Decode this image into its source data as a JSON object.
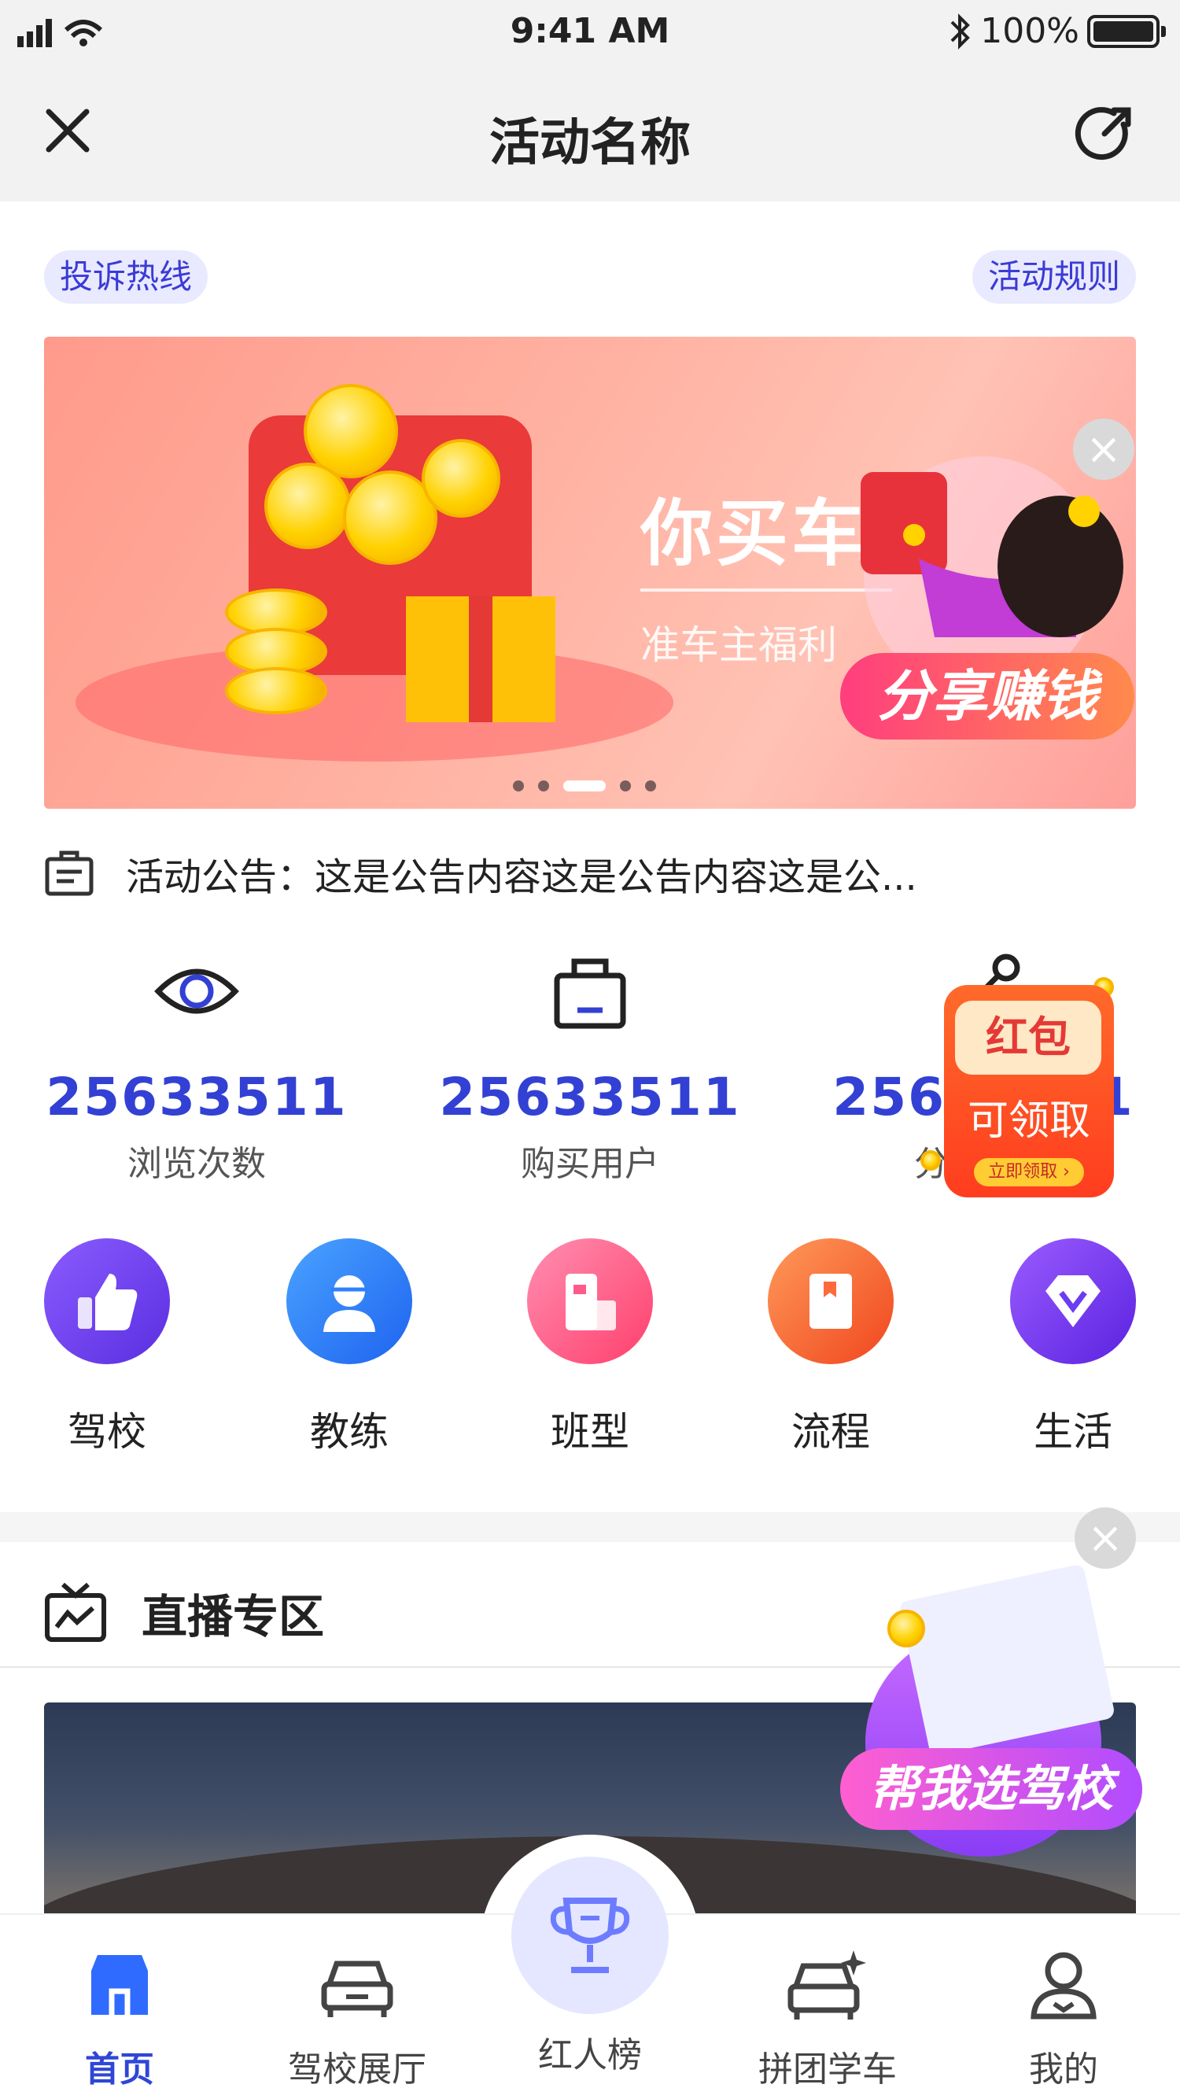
{
  "status_bar": {
    "time": "9:41 AM",
    "battery": "100%"
  },
  "nav": {
    "title": "活动名称"
  },
  "pills": {
    "complaint": "投诉热线",
    "rules": "活动规则"
  },
  "banner": {
    "headline": "你买车",
    "subline": "准车主福利",
    "carousel_total": 5,
    "carousel_active_index": 2
  },
  "share_float": {
    "label": "分享赚钱"
  },
  "notice": {
    "text": "活动公告：这是公告内容这是公告内容这是公..."
  },
  "stats": [
    {
      "value": "25633511",
      "label": "浏览次数"
    },
    {
      "value": "25633511",
      "label": "购买用户"
    },
    {
      "value": "25633511",
      "label": "分享次数"
    }
  ],
  "hongbao": {
    "title": "红包",
    "subtitle": "可领取",
    "action": "立即领取 ›"
  },
  "categories": [
    {
      "label": "驾校",
      "icon": "thumbs-up-icon",
      "color": "#6a3df0"
    },
    {
      "label": "教练",
      "icon": "coach-icon",
      "color": "#2f80ff"
    },
    {
      "label": "班型",
      "icon": "class-type-icon",
      "color": "#ff5a8a"
    },
    {
      "label": "流程",
      "icon": "process-book-icon",
      "color": "#ff6a3d"
    },
    {
      "label": "生活",
      "icon": "diamond-v-icon",
      "color": "#7b3df0"
    }
  ],
  "live": {
    "title": "直播专区"
  },
  "help_float": {
    "label": "帮我选驾校"
  },
  "tabs": [
    {
      "label": "首页",
      "icon": "home-icon",
      "active": true
    },
    {
      "label": "驾校展厅",
      "icon": "car-icon",
      "active": false
    },
    {
      "label": "红人榜",
      "icon": "trophy-icon",
      "active": false
    },
    {
      "label": "拼团学车",
      "icon": "car-sparkle-icon",
      "active": false
    },
    {
      "label": "我的",
      "icon": "user-icon",
      "active": false
    }
  ],
  "colors": {
    "accent": "#3340d4",
    "pill_bg": "#e9eaff"
  }
}
